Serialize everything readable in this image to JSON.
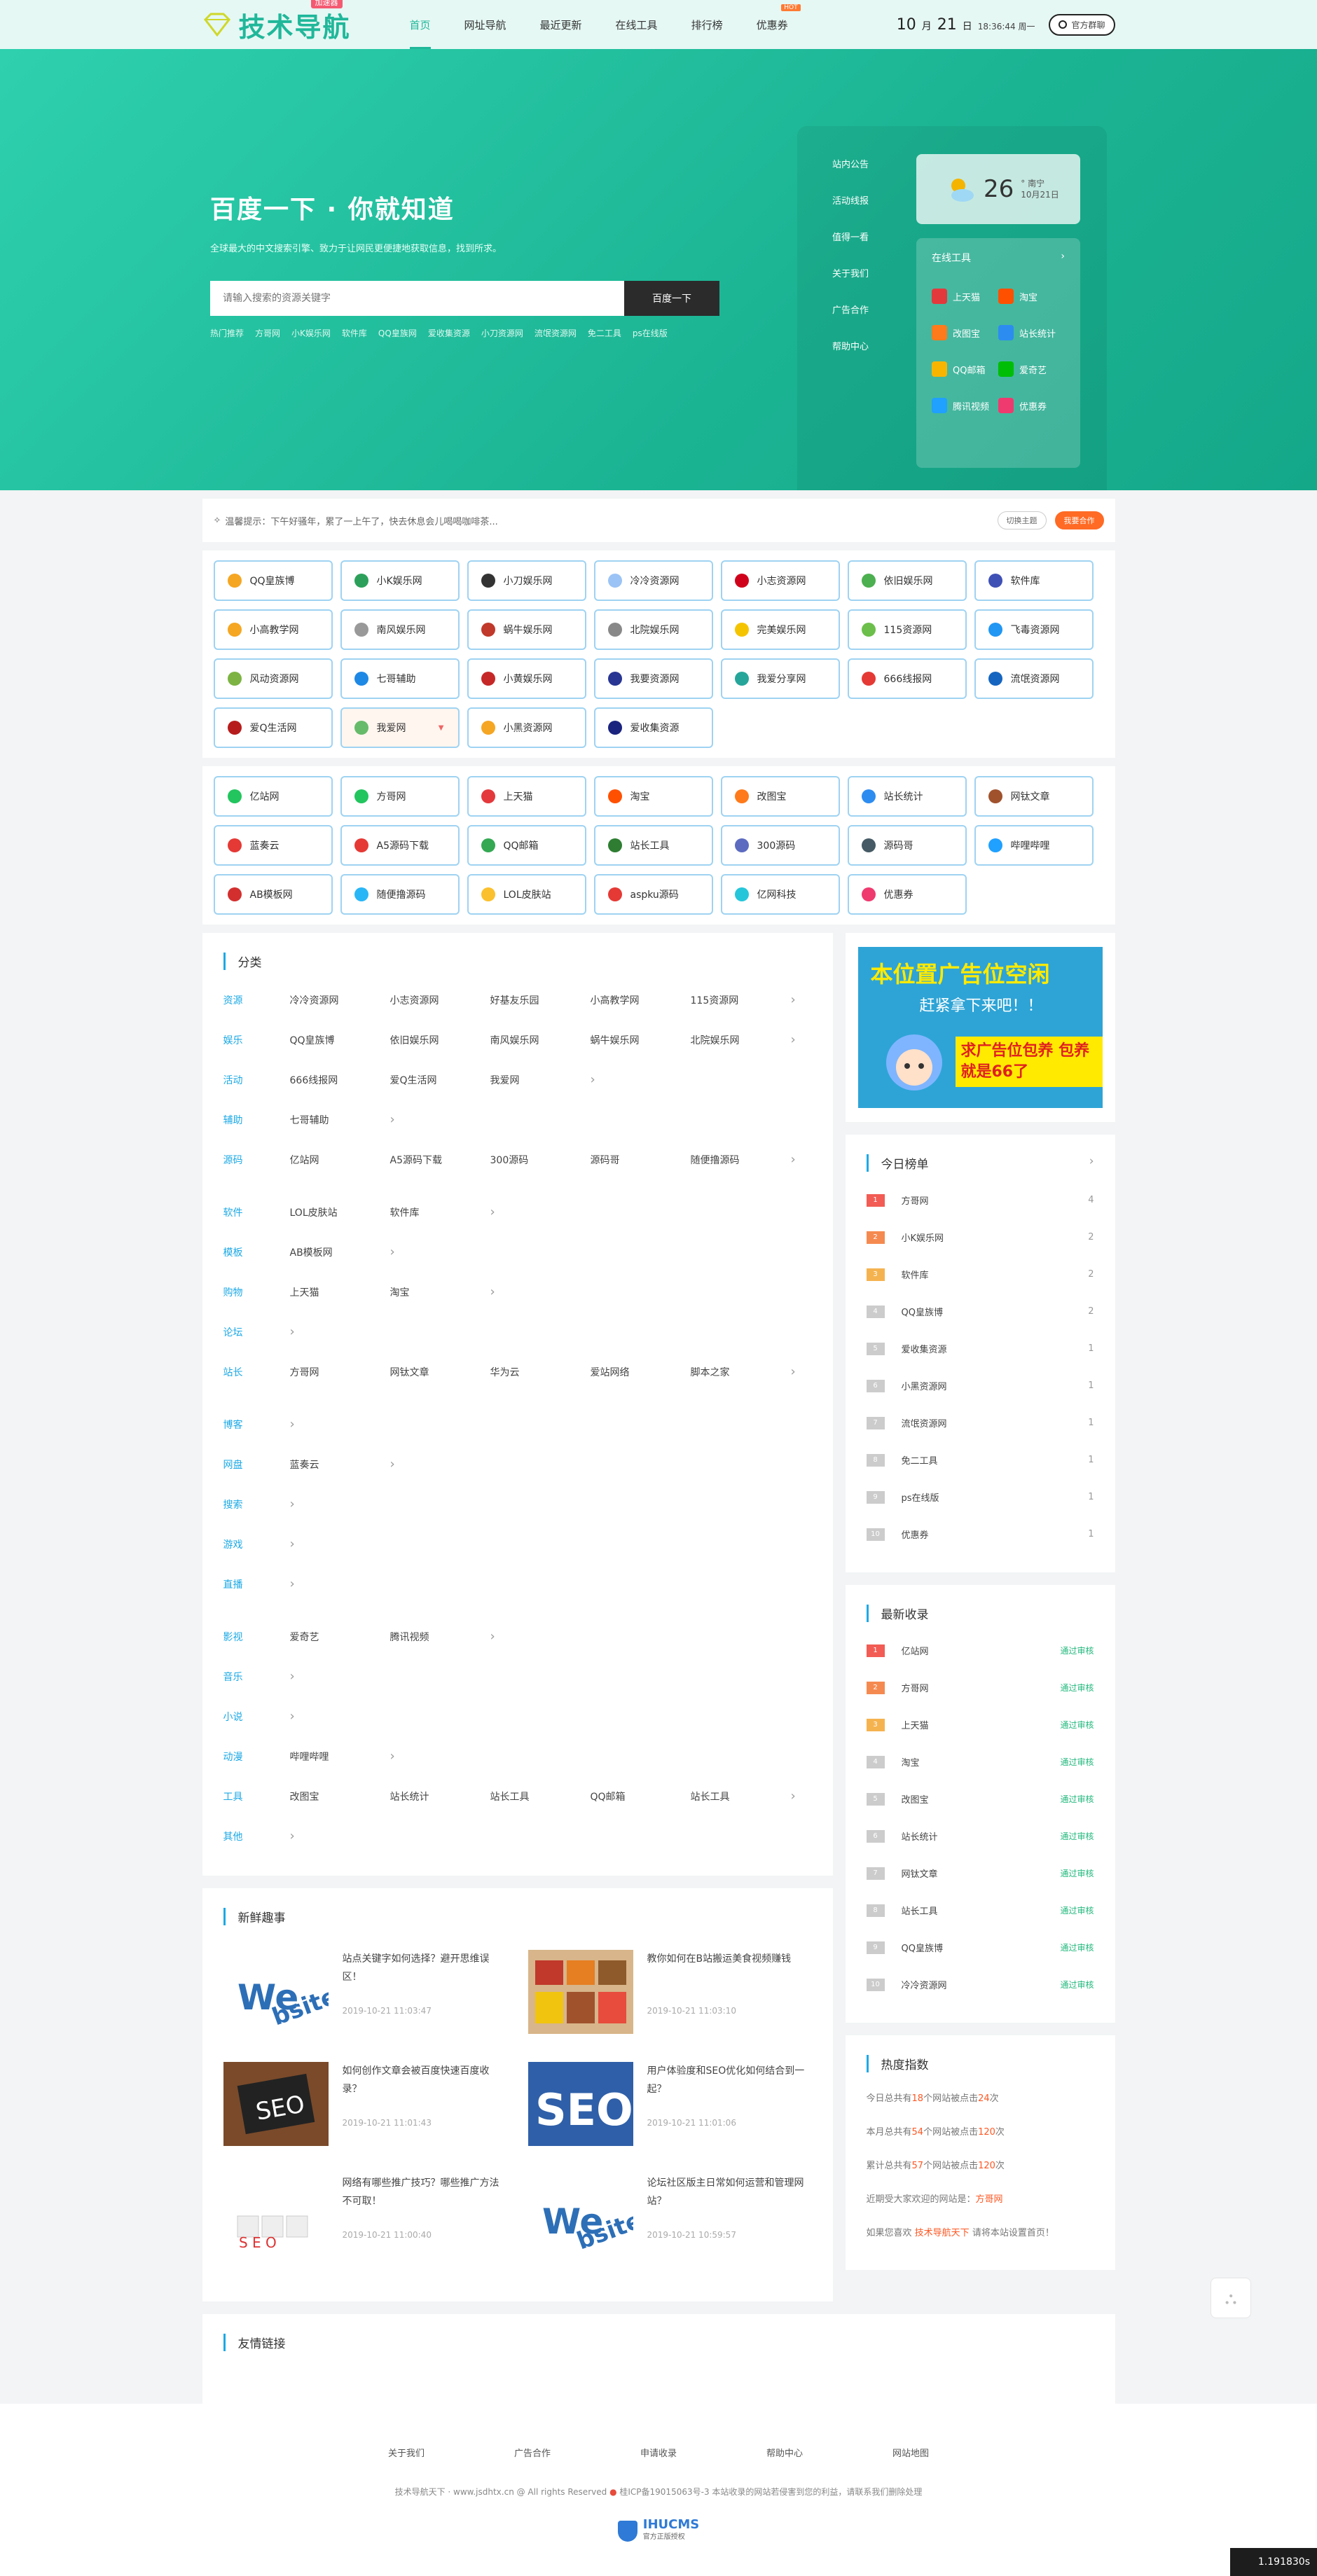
{
  "header": {
    "logo_text": "技术导航",
    "logo_badge": "加速器",
    "nav": [
      {
        "label": "首页",
        "active": true
      },
      {
        "label": "网址导航"
      },
      {
        "label": "最近更新"
      },
      {
        "label": "在线工具"
      },
      {
        "label": "排行榜"
      },
      {
        "label": "优惠券",
        "hot": "HOT"
      }
    ],
    "clock_month": "10",
    "clock_month_unit": "月",
    "clock_day": "21",
    "clock_day_unit": "日",
    "clock_time": "18:36:44 周一",
    "login_label": "官方群聊"
  },
  "hero": {
    "title": "百度一下 · 你就知道",
    "subtitle": "全球最大的中文搜索引擎、致力于让网民更便捷地获取信息，找到所求。",
    "search_placeholder": "请输入搜索的资源关键字",
    "search_button": "百度一下",
    "hotwords": [
      "热门推荐",
      "方哥网",
      "小K娱乐网",
      "软件库",
      "QQ皇族网",
      "爱收集资源",
      "小刀资源网",
      "流氓资源网",
      "免二工具",
      "ps在线版"
    ],
    "side_links": [
      "站内公告",
      "活动线报",
      "值得一看",
      "关于我们",
      "广告合作",
      "帮助中心"
    ],
    "weather": {
      "temp": "26",
      "unit": "°",
      "city": "南宁",
      "date": "10月21日"
    },
    "tools_title": "在线工具",
    "tools": [
      {
        "label": "上天猫",
        "color": "#e4393c"
      },
      {
        "label": "淘宝",
        "color": "#ff5000"
      },
      {
        "label": "改图宝",
        "color": "#ff7a1a"
      },
      {
        "label": "站长统计",
        "color": "#2d8cf0"
      },
      {
        "label": "QQ邮箱",
        "color": "#f7b500"
      },
      {
        "label": "爱奇艺",
        "color": "#00be06"
      },
      {
        "label": "腾讯视频",
        "color": "#20a0ff"
      },
      {
        "label": "优惠券",
        "color": "#ef3a6f"
      }
    ]
  },
  "notice": {
    "text": "温馨提示：下午好骚年，累了一上午了，快去休息会儿喝喝咖啡茶...",
    "theme_button": "切换主题",
    "coop_button": "我要合作"
  },
  "sites_a": [
    {
      "label": "QQ皇族博",
      "color": "#f5a623"
    },
    {
      "label": "小K娱乐网",
      "color": "#2ca05a"
    },
    {
      "label": "小刀娱乐网",
      "color": "#333"
    },
    {
      "label": "冷冷资源网",
      "color": "#9bc3f5"
    },
    {
      "label": "小志资源网",
      "color": "#d0021b"
    },
    {
      "label": "依旧娱乐网",
      "color": "#4caf50"
    },
    {
      "label": "软件库",
      "color": "#3f51b5"
    },
    {
      "label": "小高教学网",
      "color": "#f5a623"
    },
    {
      "label": "南风娱乐网",
      "color": "#999"
    },
    {
      "label": "蜗牛娱乐网",
      "color": "#c0392b"
    },
    {
      "label": "北院娱乐网",
      "color": "#888"
    },
    {
      "label": "完美娱乐网",
      "color": "#f5c400"
    },
    {
      "label": "115资源网",
      "color": "#6cbf4a"
    },
    {
      "label": "飞毒资源网",
      "color": "#2196f3"
    },
    {
      "label": "风动资源网",
      "color": "#7cb342"
    },
    {
      "label": "七哥辅助",
      "color": "#1e88e5"
    },
    {
      "label": "小黄娱乐网",
      "color": "#c62828"
    },
    {
      "label": "我要资源网",
      "color": "#283593"
    },
    {
      "label": "我爱分享网",
      "color": "#26a69a"
    },
    {
      "label": "666线报网",
      "color": "#e53935"
    },
    {
      "label": "流氓资源网",
      "color": "#1565c0"
    },
    {
      "label": "爱Q生活网",
      "color": "#b71c1c"
    },
    {
      "label": "我爱网",
      "color": "#66bb6a",
      "sel": true
    },
    {
      "label": "小黑资源网",
      "color": "#f5a623"
    },
    {
      "label": "爱收集资源",
      "color": "#1a237e"
    }
  ],
  "sites_b": [
    {
      "label": "亿站网",
      "color": "#22c55e"
    },
    {
      "label": "方哥网",
      "color": "#22c55e"
    },
    {
      "label": "上天猫",
      "color": "#e4393c"
    },
    {
      "label": "淘宝",
      "color": "#ff5000"
    },
    {
      "label": "改图宝",
      "color": "#ff7a1a"
    },
    {
      "label": "站长统计",
      "color": "#2d8cf0"
    },
    {
      "label": "网钛文章",
      "color": "#a0522d"
    },
    {
      "label": "蓝奏云",
      "color": "#e53935"
    },
    {
      "label": "A5源码下载",
      "color": "#e53935"
    },
    {
      "label": "QQ邮箱",
      "color": "#34a853"
    },
    {
      "label": "站长工具",
      "color": "#2e7d32"
    },
    {
      "label": "300源码",
      "color": "#5c6bc0"
    },
    {
      "label": "源码哥",
      "color": "#455a64"
    },
    {
      "label": "哔哩哔哩",
      "color": "#20a0ff"
    },
    {
      "label": "AB模板网",
      "color": "#d32f2f"
    },
    {
      "label": "随便撸源码",
      "color": "#29b6f6"
    },
    {
      "label": "LOL皮肤站",
      "color": "#fbc02d"
    },
    {
      "label": "aspku源码",
      "color": "#e53935"
    },
    {
      "label": "亿网科技",
      "color": "#26c6da"
    },
    {
      "label": "优惠券",
      "color": "#ef3a6f"
    }
  ],
  "categories": {
    "title": "分类",
    "rows": [
      {
        "key": "资源",
        "items": [
          "冷冷资源网",
          "小志资源网",
          "好基友乐园",
          "小高教学网",
          "115资源网"
        ],
        "more": true
      },
      {
        "key": "娱乐",
        "items": [
          "QQ皇族博",
          "依旧娱乐网",
          "南风娱乐网",
          "蜗牛娱乐网",
          "北院娱乐网"
        ],
        "more": true
      },
      {
        "key": "活动",
        "items": [
          "666线报网",
          "爱Q生活网",
          "我爱网"
        ],
        "more": true
      },
      {
        "key": "辅助",
        "items": [
          "七哥辅助"
        ],
        "more": true
      },
      {
        "key": "源码",
        "items": [
          "亿站网",
          "A5源码下载",
          "300源码",
          "源码哥",
          "随便撸源码"
        ],
        "more": true
      },
      {
        "key": "软件",
        "items": [
          "LOL皮肤站",
          "软件库"
        ],
        "more": true
      },
      {
        "key": "模板",
        "items": [
          "AB模板网"
        ],
        "more": true
      },
      {
        "key": "购物",
        "items": [
          "上天猫",
          "淘宝"
        ],
        "more": true
      },
      {
        "key": "论坛",
        "items": [],
        "more": true
      },
      {
        "key": "站长",
        "items": [
          "方哥网",
          "网钛文章",
          "华为云",
          "爱站网络",
          "脚本之家"
        ],
        "more": true
      },
      {
        "key": "博客",
        "items": [],
        "more": true
      },
      {
        "key": "网盘",
        "items": [
          "蓝奏云"
        ],
        "more": true
      },
      {
        "key": "搜索",
        "items": [],
        "more": true
      },
      {
        "key": "游戏",
        "items": [],
        "more": true
      },
      {
        "key": "直播",
        "items": [],
        "more": true
      },
      {
        "key": "影视",
        "items": [
          "爱奇艺",
          "腾讯视频"
        ],
        "more": true
      },
      {
        "key": "音乐",
        "items": [],
        "more": true
      },
      {
        "key": "小说",
        "items": [],
        "more": true
      },
      {
        "key": "动漫",
        "items": [
          "哔哩哔哩"
        ],
        "more": true
      },
      {
        "key": "工具",
        "items": [
          "改图宝",
          "站长统计",
          "站长工具",
          "QQ邮箱",
          "站长工具"
        ],
        "more": true
      },
      {
        "key": "其他",
        "items": [],
        "more": true
      }
    ]
  },
  "news": {
    "title": "新鲜趣事",
    "items": [
      {
        "title": "站点关键字如何选择？避开思维误区！",
        "date": "2019-10-21 11:03:47",
        "thumb": "web"
      },
      {
        "title": "教你如何在B站搬运美食视频赚钱",
        "date": "2019-10-21 11:03:10",
        "thumb": "food"
      },
      {
        "title": "如何创作文章会被百度快速百度收录？",
        "date": "2019-10-21 11:01:43",
        "thumb": "seo-board"
      },
      {
        "title": "用户体验度和SEO优化如何结合到一起？",
        "date": "2019-10-21 11:01:06",
        "thumb": "seo"
      },
      {
        "title": "网络有哪些推广技巧？哪些推广方法不可取！",
        "date": "2019-10-21 11:00:40",
        "thumb": "cubes"
      },
      {
        "title": "论坛社区版主日常如何运营和管理网站？",
        "date": "2019-10-21 10:59:57",
        "thumb": "web"
      }
    ]
  },
  "ad": {
    "line1": "本位置广告位空闲",
    "line2": "赶紧拿下来吧！！",
    "line3": "求广告位包养 包养就是66了"
  },
  "today_rank": {
    "title": "今日榜单",
    "items": [
      {
        "n": "1",
        "label": "方哥网",
        "count": "4"
      },
      {
        "n": "2",
        "label": "小K娱乐网",
        "count": "2"
      },
      {
        "n": "3",
        "label": "软件库",
        "count": "2"
      },
      {
        "n": "4",
        "label": "QQ皇族博",
        "count": "2"
      },
      {
        "n": "5",
        "label": "爱收集资源",
        "count": "1"
      },
      {
        "n": "6",
        "label": "小黑资源网",
        "count": "1"
      },
      {
        "n": "7",
        "label": "流氓资源网",
        "count": "1"
      },
      {
        "n": "8",
        "label": "免二工具",
        "count": "1"
      },
      {
        "n": "9",
        "label": "ps在线版",
        "count": "1"
      },
      {
        "n": "10",
        "label": "优惠券",
        "count": "1"
      }
    ]
  },
  "latest": {
    "title": "最新收录",
    "status": "通过审核",
    "items": [
      "亿站网",
      "方哥网",
      "上天猫",
      "淘宝",
      "改图宝",
      "站长统计",
      "网钛文章",
      "站长工具",
      "QQ皇族博",
      "冷冷资源网"
    ]
  },
  "heat": {
    "title": "热度指数",
    "today_pre": "今日总共有",
    "today_n": "18",
    "today_mid": "个网站被点击",
    "today_c": "24",
    "today_end": "次",
    "month_pre": "本月总共有",
    "month_n": "54",
    "month_mid": "个网站被点击",
    "month_c": "120",
    "month_end": "次",
    "total_pre": "累计总共有",
    "total_n": "57",
    "total_mid": "个网站被点击",
    "total_c": "120",
    "total_end": "次",
    "popular_pre": "近期受大家欢迎的网站是：",
    "popular": "方哥网",
    "home_pre": "如果您喜欢",
    "home_link": "技术导航天下",
    "home_end": "请将本站设置首页！"
  },
  "friend_title": "友情链接",
  "footer": {
    "links": [
      "关于我们",
      "广告合作",
      "申请收录",
      "帮助中心",
      "网站地图"
    ],
    "copyright": "技术导航天下 · www.jsdhtx.cn @ All rights Reserved",
    "icp": "桂ICP备19015063号-3",
    "notice": "本站收录的网站若侵害到您的利益，请联系我们删除处理",
    "cms_name": "IHUCMS",
    "cms_sub": "官方正版授权"
  },
  "corner_text": "1.191830s"
}
